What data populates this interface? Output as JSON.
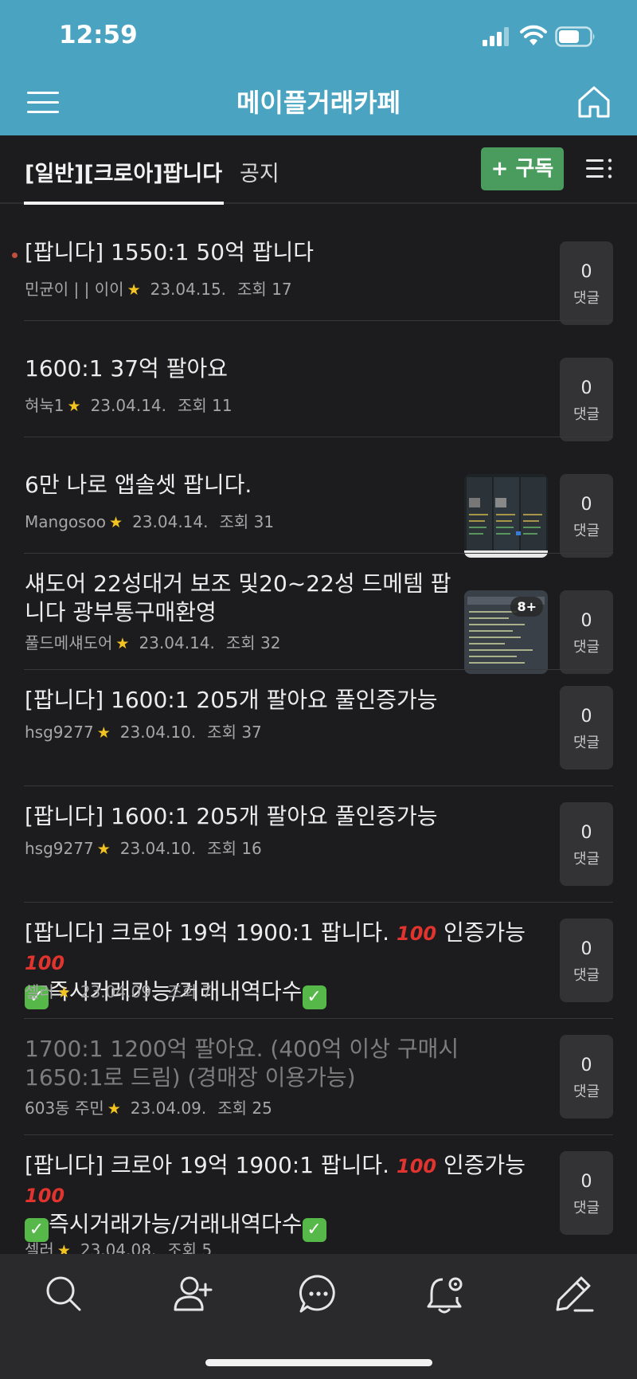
{
  "status_bar": {
    "time": "12:59"
  },
  "header": {
    "title": "메이플거래카페"
  },
  "tabs": {
    "active": "[일반][크로아]팝니다",
    "notice": "공지"
  },
  "subscribe_label": "+ 구독",
  "comment_label": "댓글",
  "posts": [
    {
      "title": "[팝니다] 1550:1 50억 팝니다",
      "author": "민균이 |  | 이이",
      "date": "23.04.15.",
      "views": "조회 17",
      "comments": "0"
    },
    {
      "title": "1600:1 37억 팔아요",
      "author": "혀눅1",
      "date": "23.04.14.",
      "views": "조회 11",
      "comments": "0"
    },
    {
      "title": "6만 나로 앱솔셋 팝니다.",
      "author": "Mangosoo",
      "date": "23.04.14.",
      "views": "조회 31",
      "comments": "0"
    },
    {
      "title": "섀도어 22성대거 보조 및20~22성 드메템 팝니다 광부통구매환영",
      "author": "풀드메섀도어",
      "date": "23.04.14.",
      "views": "조회 32",
      "comments": "0",
      "thumb_badge": "8+"
    },
    {
      "title": "[팝니다] 1600:1 205개 팔아요 풀인증가능",
      "author": "hsg9277",
      "date": "23.04.10.",
      "views": "조회 37",
      "comments": "0"
    },
    {
      "title": "[팝니다] 1600:1 205개 팔아요 풀인증가능",
      "author": "hsg9277",
      "date": "23.04.10.",
      "views": "조회 16",
      "comments": "0"
    },
    {
      "title_a": "[팝니다] 크로아 19억 1900:1 팝니다.",
      "title_b": "인증가능",
      "title_c": "즉시거래가능/거래내역다수",
      "author": "셀러",
      "date": "23.04.09.",
      "views": "조회 7",
      "comments": "0"
    },
    {
      "title": "1700:1 1200억 팔아요.  (400억 이상 구매시 1650:1로 드림) (경매장 이용가능)",
      "author": "603동 주민",
      "date": "23.04.09.",
      "views": "조회 25",
      "comments": "0"
    },
    {
      "title_a": "[팝니다] 크로아 19억 1900:1 팝니다.",
      "title_b": "인증가능",
      "title_c": "즉시거래가능/거래내역다수",
      "author": "셀러",
      "date": "23.04.08.",
      "views": "조회 5",
      "comments": "0"
    }
  ],
  "colors": {
    "header": "#4aa4c1",
    "background": "#1c1c1e",
    "subscribe": "#4a9c5e",
    "star": "#f3c320"
  }
}
